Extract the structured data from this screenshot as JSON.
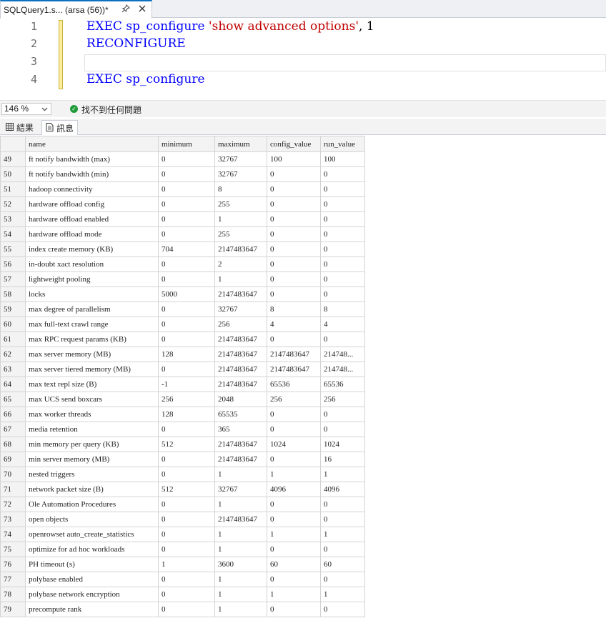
{
  "tab": {
    "title": "SQLQuery1.s... (arsa (56))*",
    "pin_icon": "pin-icon",
    "close_icon": "close-icon"
  },
  "editor": {
    "line_numbers": [
      "1",
      "2",
      "3",
      "4"
    ],
    "line1": {
      "kw": "EXEC",
      "ident": " sp_configure ",
      "str": "'show advanced options'",
      "rest": ", 1"
    },
    "line2": {
      "kw": "RECONFIGURE"
    },
    "line4": {
      "kw": "EXEC",
      "ident": " sp_configure"
    }
  },
  "status": {
    "zoom": "146 %",
    "message": "找不到任何問題"
  },
  "result_tabs": {
    "results": "結果",
    "messages": "訊息"
  },
  "grid": {
    "columns": [
      "name",
      "minimum",
      "maximum",
      "config_value",
      "run_value"
    ],
    "rows": [
      [
        "49",
        "ft notify bandwidth (max)",
        "0",
        "32767",
        "100",
        "100"
      ],
      [
        "50",
        "ft notify bandwidth (min)",
        "0",
        "32767",
        "0",
        "0"
      ],
      [
        "51",
        "hadoop connectivity",
        "0",
        "8",
        "0",
        "0"
      ],
      [
        "52",
        "hardware offload config",
        "0",
        "255",
        "0",
        "0"
      ],
      [
        "53",
        "hardware offload enabled",
        "0",
        "1",
        "0",
        "0"
      ],
      [
        "54",
        "hardware offload mode",
        "0",
        "255",
        "0",
        "0"
      ],
      [
        "55",
        "index create memory (KB)",
        "704",
        "2147483647",
        "0",
        "0"
      ],
      [
        "56",
        "in-doubt xact resolution",
        "0",
        "2",
        "0",
        "0"
      ],
      [
        "57",
        "lightweight pooling",
        "0",
        "1",
        "0",
        "0"
      ],
      [
        "58",
        "locks",
        "5000",
        "2147483647",
        "0",
        "0"
      ],
      [
        "59",
        "max degree of parallelism",
        "0",
        "32767",
        "8",
        "8"
      ],
      [
        "60",
        "max full-text crawl range",
        "0",
        "256",
        "4",
        "4"
      ],
      [
        "61",
        "max RPC request params (KB)",
        "0",
        "2147483647",
        "0",
        "0"
      ],
      [
        "62",
        "max server memory (MB)",
        "128",
        "2147483647",
        "2147483647",
        "214748..."
      ],
      [
        "63",
        "max server tiered memory (MB)",
        "0",
        "2147483647",
        "2147483647",
        "214748..."
      ],
      [
        "64",
        "max text repl size (B)",
        "-1",
        "2147483647",
        "65536",
        "65536"
      ],
      [
        "65",
        "max UCS send boxcars",
        "256",
        "2048",
        "256",
        "256"
      ],
      [
        "66",
        "max worker threads",
        "128",
        "65535",
        "0",
        "0"
      ],
      [
        "67",
        "media retention",
        "0",
        "365",
        "0",
        "0"
      ],
      [
        "68",
        "min memory per query (KB)",
        "512",
        "2147483647",
        "1024",
        "1024"
      ],
      [
        "69",
        "min server memory (MB)",
        "0",
        "2147483647",
        "0",
        "16"
      ],
      [
        "70",
        "nested triggers",
        "0",
        "1",
        "1",
        "1"
      ],
      [
        "71",
        "network packet size (B)",
        "512",
        "32767",
        "4096",
        "4096"
      ],
      [
        "72",
        "Ole Automation Procedures",
        "0",
        "1",
        "0",
        "0"
      ],
      [
        "73",
        "open objects",
        "0",
        "2147483647",
        "0",
        "0"
      ],
      [
        "74",
        "openrowset auto_create_statistics",
        "0",
        "1",
        "1",
        "1"
      ],
      [
        "75",
        "optimize for ad hoc workloads",
        "0",
        "1",
        "0",
        "0"
      ],
      [
        "76",
        "PH timeout (s)",
        "1",
        "3600",
        "60",
        "60"
      ],
      [
        "77",
        "polybase enabled",
        "0",
        "1",
        "0",
        "0"
      ],
      [
        "78",
        "polybase network encryption",
        "0",
        "1",
        "1",
        "1"
      ],
      [
        "79",
        "precompute rank",
        "0",
        "1",
        "0",
        "0"
      ]
    ]
  }
}
